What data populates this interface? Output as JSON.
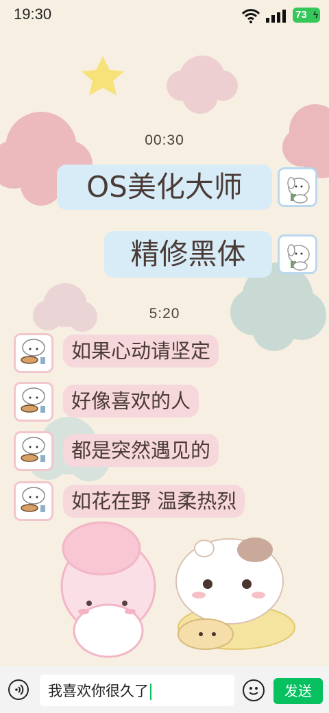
{
  "status_bar": {
    "time": "19:30",
    "battery": "73"
  },
  "messages": [
    {
      "timestamp": "00:30"
    },
    {
      "side": "right",
      "text": "OS美化大师"
    },
    {
      "side": "right",
      "text": "精修黑体"
    },
    {
      "timestamp": "5:20"
    },
    {
      "side": "left",
      "text": "如果心动请坚定"
    },
    {
      "side": "left",
      "text": "好像喜欢的人"
    },
    {
      "side": "left",
      "text": "都是突然遇见的"
    },
    {
      "side": "left",
      "text": "如花在野 温柔热烈"
    }
  ],
  "input_bar": {
    "input_value": "我喜欢你很久了",
    "send_label": "发送"
  },
  "colors": {
    "accent": "#07c160",
    "right_bubble": "#d7ecf7",
    "left_bubble": "#f6d7dc"
  }
}
